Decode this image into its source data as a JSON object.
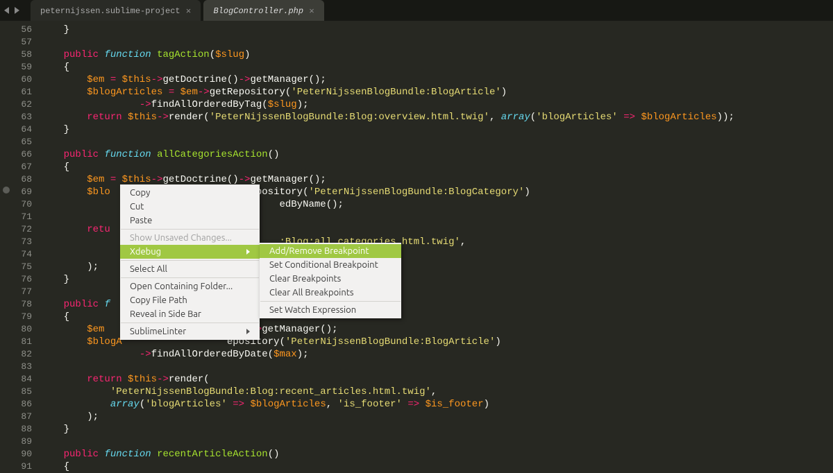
{
  "tabs": [
    {
      "label": "peternijssen.sublime-project",
      "active": false
    },
    {
      "label": "BlogController.php",
      "active": true
    }
  ],
  "line_start": 56,
  "line_end": 91,
  "breakpoint_line": 69,
  "context_menu": {
    "items": [
      {
        "label": "Copy",
        "type": "item"
      },
      {
        "label": "Cut",
        "type": "item"
      },
      {
        "label": "Paste",
        "type": "item"
      },
      {
        "type": "sep"
      },
      {
        "label": "Show Unsaved Changes...",
        "type": "item",
        "disabled": true
      },
      {
        "label": "Xdebug",
        "type": "submenu",
        "highlight": true
      },
      {
        "type": "sep"
      },
      {
        "label": "Select All",
        "type": "item"
      },
      {
        "type": "sep"
      },
      {
        "label": "Open Containing Folder...",
        "type": "item"
      },
      {
        "label": "Copy File Path",
        "type": "item"
      },
      {
        "label": "Reveal in Side Bar",
        "type": "item"
      },
      {
        "type": "sep"
      },
      {
        "label": "SublimeLinter",
        "type": "submenu"
      }
    ]
  },
  "sub_context_menu": {
    "items": [
      {
        "label": "Add/Remove Breakpoint",
        "highlight": true
      },
      {
        "label": "Set Conditional Breakpoint"
      },
      {
        "label": "Clear Breakpoints"
      },
      {
        "label": "Clear All Breakpoints"
      },
      {
        "type": "sep"
      },
      {
        "label": "Set Watch Expression"
      }
    ]
  },
  "code_lines": [
    {
      "n": 56,
      "html": "    <span class='pn'>}</span>"
    },
    {
      "n": 57,
      "html": ""
    },
    {
      "n": 58,
      "html": "    <span class='k-acc'>public</span> <span class='k-type'>function</span> <span class='fn'>tagAction</span><span class='pn'>(</span><span class='var'>$slug</span><span class='pn'>)</span>"
    },
    {
      "n": 59,
      "html": "    <span class='pn'>{</span>"
    },
    {
      "n": 60,
      "html": "        <span class='var'>$em</span> <span class='k-acc'>=</span> <span class='var'>$this</span><span class='op'>-></span><span class='mcall'>getDoctrine</span><span class='pn'>()</span><span class='op'>-></span><span class='mcall'>getManager</span><span class='pn'>();</span>"
    },
    {
      "n": 61,
      "html": "        <span class='var'>$blogArticles</span> <span class='k-acc'>=</span> <span class='var'>$em</span><span class='op'>-></span><span class='mcall'>getRepository</span><span class='pn'>(</span><span class='str'>'PeterNijssenBlogBundle:BlogArticle'</span><span class='pn'>)</span>"
    },
    {
      "n": 62,
      "html": "                 <span class='op'>-></span><span class='mcall'>findAllOrderedByTag</span><span class='pn'>(</span><span class='var'>$slug</span><span class='pn'>);</span>"
    },
    {
      "n": 63,
      "html": "        <span class='k-acc'>return</span> <span class='var'>$this</span><span class='op'>-></span><span class='mcall'>render</span><span class='pn'>(</span><span class='str'>'PeterNijssenBlogBundle:Blog:overview.html.twig'</span><span class='pn'>, </span><span class='k-type'>array</span><span class='pn'>(</span><span class='str'>'blogArticles'</span> <span class='k-acc'>=></span> <span class='var'>$blogArticles</span><span class='pn'>));</span>"
    },
    {
      "n": 64,
      "html": "    <span class='pn'>}</span>"
    },
    {
      "n": 65,
      "html": ""
    },
    {
      "n": 66,
      "html": "    <span class='k-acc'>public</span> <span class='k-type'>function</span> <span class='fn'>allCategoriesAction</span><span class='pn'>()</span>"
    },
    {
      "n": 67,
      "html": "    <span class='pn'>{</span>"
    },
    {
      "n": 68,
      "html": "        <span class='var'>$em</span> <span class='k-acc'>=</span> <span class='var'>$this</span><span class='op'>-></span><span class='mcall'>getDoctrine</span><span class='pn'>()</span><span class='op'>-></span><span class='mcall'>getManager</span><span class='pn'>();</span>"
    },
    {
      "n": 69,
      "html": "        <span class='var'>$blo</span>                        <span class='mcall'>epository</span><span class='pn'>(</span><span class='str'>'PeterNijssenBlogBundle:BlogCategory'</span><span class='pn'>)</span>"
    },
    {
      "n": 70,
      "html": "                                         <span class='mcall'>edByName</span><span class='pn'>();</span>"
    },
    {
      "n": 71,
      "html": ""
    },
    {
      "n": 72,
      "html": "        <span class='k-acc'>retu</span>"
    },
    {
      "n": 73,
      "html": "                                         <span class='str'>:Blog:all_categories.html.twig'</span><span class='pn'>,</span>"
    },
    {
      "n": 74,
      "html": ""
    },
    {
      "n": 75,
      "html": "        <span class='pn'>);</span>"
    },
    {
      "n": 76,
      "html": "    <span class='pn'>}</span>"
    },
    {
      "n": 77,
      "html": ""
    },
    {
      "n": 78,
      "html": "    <span class='k-acc'>public</span> <span class='k-type'>f</span>"
    },
    {
      "n": 79,
      "html": "    <span class='pn'>{</span>"
    },
    {
      "n": 80,
      "html": "        <span class='var'>$em</span>                          <span class='op'>></span><span class='mcall'>getManager</span><span class='pn'>();</span>"
    },
    {
      "n": 81,
      "html": "        <span class='var'>$blogA</span>             <span class='pn'>   </span><span class='mcall'>  epository</span><span class='pn'>(</span><span class='str'>'PeterNijssenBlogBundle:BlogArticle'</span><span class='pn'>)</span>"
    },
    {
      "n": 82,
      "html": "                 <span class='op'>-></span><span class='mcall'>findAllOrderedByDate</span><span class='pn'>(</span><span class='var'>$max</span><span class='pn'>);</span>"
    },
    {
      "n": 83,
      "html": ""
    },
    {
      "n": 84,
      "html": "        <span class='k-acc'>return</span> <span class='var'>$this</span><span class='op'>-></span><span class='mcall'>render</span><span class='pn'>(</span>"
    },
    {
      "n": 85,
      "html": "            <span class='str'>'PeterNijssenBlogBundle:Blog:recent_articles.html.twig'</span><span class='pn'>,</span>"
    },
    {
      "n": 86,
      "html": "            <span class='k-type'>array</span><span class='pn'>(</span><span class='str'>'blogArticles'</span> <span class='k-acc'>=></span> <span class='var'>$blogArticles</span><span class='pn'>, </span><span class='str'>'is_footer'</span> <span class='k-acc'>=></span> <span class='var'>$is_footer</span><span class='pn'>)</span>"
    },
    {
      "n": 87,
      "html": "        <span class='pn'>);</span>"
    },
    {
      "n": 88,
      "html": "    <span class='pn'>}</span>"
    },
    {
      "n": 89,
      "html": ""
    },
    {
      "n": 90,
      "html": "    <span class='k-acc'>public</span> <span class='k-type'>function</span> <span class='fn'>recentArticleAction</span><span class='pn'>()</span>"
    },
    {
      "n": 91,
      "html": "    <span class='pn'>{</span>"
    }
  ]
}
